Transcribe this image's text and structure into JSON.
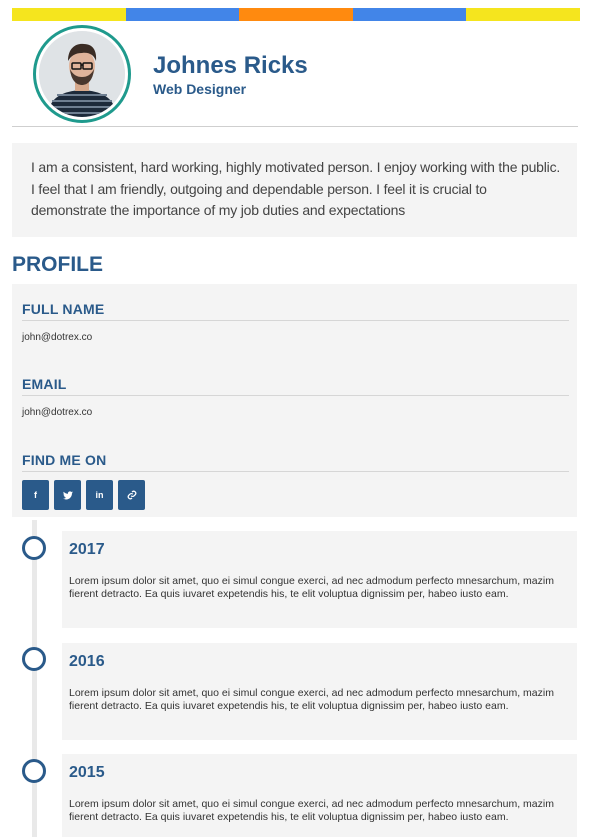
{
  "colors": {
    "accent": "#2a5a8a",
    "ring": "#1f9a8d",
    "panel": "#f4f4f4",
    "bar": [
      "#f5e51e",
      "#4285e8",
      "#ff8a0f",
      "#4285e8",
      "#f5e51e"
    ]
  },
  "header": {
    "name": "Johnes Ricks",
    "role": "Web Designer",
    "avatar": "portrait-photo"
  },
  "about": {
    "lines": [
      "I am a consistent, hard working, highly motivated person. I enjoy working with the public.",
      "I feel that I am friendly, outgoing and dependable person. I feel it is crucial to",
      "demonstrate the importance of my job duties and expectations"
    ]
  },
  "profile": {
    "title": "PROFILE",
    "full_name_label": "FULL NAME",
    "full_name_value": "john@dotrex.co",
    "email_label": "EMAIL",
    "email_value": "john@dotrex.co",
    "find_me_label": "FIND ME ON",
    "social": [
      {
        "icon": "facebook-icon",
        "glyph": "f"
      },
      {
        "icon": "twitter-icon",
        "glyph": ""
      },
      {
        "icon": "linkedin-icon",
        "glyph": "in"
      },
      {
        "icon": "link-icon",
        "glyph": ""
      }
    ]
  },
  "timeline": [
    {
      "year": "2017",
      "text": "Lorem ipsum dolor sit amet, quo ei simul congue exerci, ad nec admodum perfecto mnesarchum, mazim fierent detracto. Ea quis iuvaret expetendis his, te elit voluptua dignissim per, habeo iusto eam."
    },
    {
      "year": "2016",
      "text": "Lorem ipsum dolor sit amet, quo ei simul congue exerci, ad nec admodum perfecto mnesarchum, mazim fierent detracto. Ea quis iuvaret expetendis his, te elit voluptua dignissim per, habeo iusto eam."
    },
    {
      "year": "2015",
      "text": "Lorem ipsum dolor sit amet, quo ei simul congue exerci, ad nec admodum perfecto mnesarchum, mazim fierent detracto. Ea quis iuvaret expetendis his, te elit voluptua dignissim per, habeo iusto eam."
    }
  ]
}
